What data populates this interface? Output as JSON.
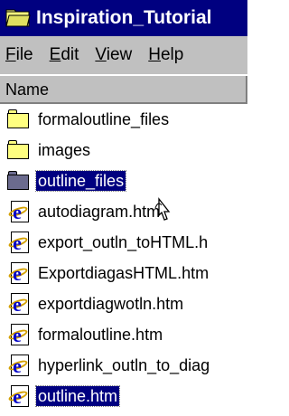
{
  "window": {
    "title": "Inspiration_Tutorial",
    "title_icon": "folder-icon"
  },
  "menu": [
    {
      "label": "File",
      "underline": "F"
    },
    {
      "label": "Edit",
      "underline": "E"
    },
    {
      "label": "View",
      "underline": "V"
    },
    {
      "label": "Help",
      "underline": "H"
    }
  ],
  "list": {
    "column_header": "Name",
    "items": [
      {
        "label": "formaloutline_files",
        "icon": "folder-icon",
        "selected": false
      },
      {
        "label": "images",
        "icon": "folder-icon",
        "selected": false
      },
      {
        "label": "outline_files",
        "icon": "folder-icon",
        "selected": true
      },
      {
        "label": "autodiagram.htm",
        "icon": "ie-html-file-icon",
        "selected": false
      },
      {
        "label": "export_outln_toHTML.h",
        "icon": "ie-html-file-icon",
        "selected": false
      },
      {
        "label": "ExportdiagasHTML.htm",
        "icon": "ie-html-file-icon",
        "selected": false
      },
      {
        "label": "exportdiagwotln.htm",
        "icon": "ie-html-file-icon",
        "selected": false
      },
      {
        "label": "formaloutline.htm",
        "icon": "ie-html-file-icon",
        "selected": false
      },
      {
        "label": "hyperlink_outln_to_diag",
        "icon": "ie-html-file-icon",
        "selected": false
      },
      {
        "label": "outline.htm",
        "icon": "ie-html-file-icon",
        "selected": true
      }
    ]
  },
  "colors": {
    "titlebar": "#000080",
    "selection": "#000080",
    "folder": "#ffff80",
    "folder_selected": "#6b6b8e",
    "chrome": "#c0c0c0"
  }
}
